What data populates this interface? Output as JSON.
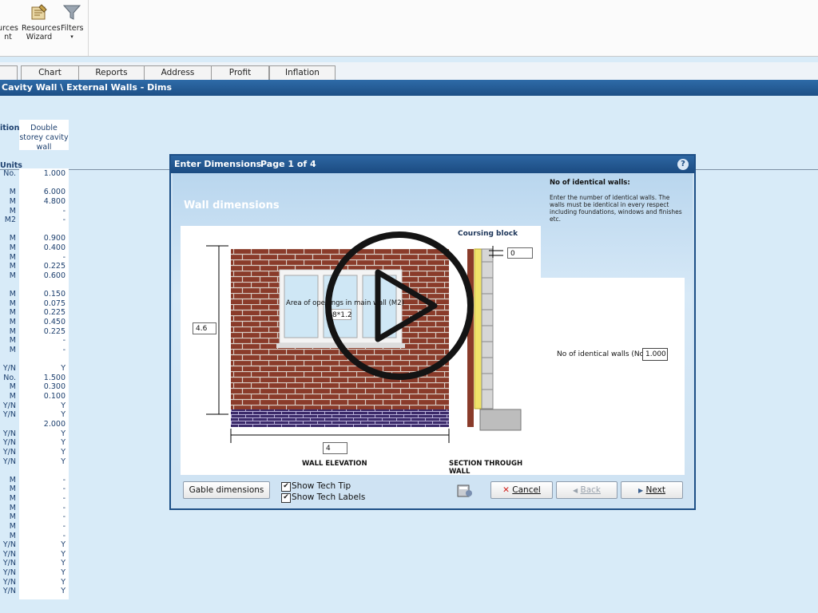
{
  "ribbon": {
    "resources_cut_label_1": "urces",
    "resources_cut_label_2": "nt",
    "resources_wizard_label_1": "Resources",
    "resources_wizard_label_2": "Wizard",
    "filters_label": "Filters",
    "filters_arrow": "▾"
  },
  "tabs": [
    "Chart",
    "Reports",
    "Address",
    "Profit",
    "Inflation"
  ],
  "title_bar": "Cavity Wall \\ External Walls - Dims",
  "grid": {
    "section_label": "ition",
    "units_label": "Units",
    "column_header": "Double storey cavity wall",
    "rows": [
      {
        "unit": "No.",
        "value": "1.000"
      },
      {
        "unit": "",
        "value": ""
      },
      {
        "unit": "M",
        "value": "6.000"
      },
      {
        "unit": "M",
        "value": "4.800"
      },
      {
        "unit": "M",
        "value": "-"
      },
      {
        "unit": "M2",
        "value": "-"
      },
      {
        "unit": "",
        "value": ""
      },
      {
        "unit": "M",
        "value": "0.900"
      },
      {
        "unit": "M",
        "value": "0.400"
      },
      {
        "unit": "M",
        "value": "-"
      },
      {
        "unit": "M",
        "value": "0.225"
      },
      {
        "unit": "M",
        "value": "0.600"
      },
      {
        "unit": "",
        "value": ""
      },
      {
        "unit": "M",
        "value": "0.150"
      },
      {
        "unit": "M",
        "value": "0.075"
      },
      {
        "unit": "M",
        "value": "0.225"
      },
      {
        "unit": "M",
        "value": "0.450"
      },
      {
        "unit": "M",
        "value": "0.225"
      },
      {
        "unit": "M",
        "value": "-"
      },
      {
        "unit": "M",
        "value": "-"
      },
      {
        "unit": "",
        "value": ""
      },
      {
        "unit": "Y/N",
        "value": "Y"
      },
      {
        "unit": "No.",
        "value": "1.500"
      },
      {
        "unit": "M",
        "value": "0.300"
      },
      {
        "unit": "M",
        "value": "0.100"
      },
      {
        "unit": "Y/N",
        "value": "Y"
      },
      {
        "unit": "Y/N",
        "value": "Y"
      },
      {
        "unit": "",
        "value": "2.000"
      },
      {
        "unit": "Y/N",
        "value": "Y"
      },
      {
        "unit": "Y/N",
        "value": "Y"
      },
      {
        "unit": "Y/N",
        "value": "Y"
      },
      {
        "unit": "Y/N",
        "value": "Y"
      },
      {
        "unit": "",
        "value": ""
      },
      {
        "unit": "M",
        "value": "-"
      },
      {
        "unit": "M",
        "value": "-"
      },
      {
        "unit": "M",
        "value": "-"
      },
      {
        "unit": "M",
        "value": "-"
      },
      {
        "unit": "M",
        "value": "-"
      },
      {
        "unit": "M",
        "value": "-"
      },
      {
        "unit": "M",
        "value": "-"
      },
      {
        "unit": "Y/N",
        "value": "Y"
      },
      {
        "unit": "Y/N",
        "value": "Y"
      },
      {
        "unit": "Y/N",
        "value": "Y"
      },
      {
        "unit": "Y/N",
        "value": "Y"
      },
      {
        "unit": "Y/N",
        "value": "Y"
      },
      {
        "unit": "Y/N",
        "value": "Y"
      }
    ]
  },
  "dialog": {
    "title": "Enter Dimensions",
    "page": "Page 1 of 4",
    "help_glyph": "?",
    "heading": "Wall dimensions",
    "tip_title": "No of identical walls:",
    "tip_text": "Enter the number of identical walls. The walls must be identical in every respect including foundations, windows and finishes etc.",
    "coursing_label": "Coursing block",
    "coursing_value": "0",
    "height_value": "4.6",
    "width_value": "4",
    "openings_label": "Area of openings in main wall (M2)",
    "openings_value": "8*1.2",
    "identical_label": "No of identical walls (No.)",
    "identical_value": "1.000",
    "elevation_caption": "WALL ELEVATION",
    "section_caption": "SECTION THROUGH WALL",
    "gable_button": "Gable dimensions",
    "show_tech_tip": "Show Tech Tip",
    "show_tech_labels": "Show Tech Labels",
    "check_mark": "✔",
    "cancel": "Cancel",
    "back": "Back",
    "next": "Next",
    "cancel_icon": "✕",
    "back_icon": "◀",
    "next_icon": "▶"
  },
  "colors": {
    "title_blue": "#1d4f86",
    "brick": "#8a3b2a",
    "cancel_red": "#d0201c"
  },
  "icons": [
    "resources-wizard-icon",
    "filter-funnel-icon",
    "help-icon",
    "play-overlay-icon",
    "calculator-icon"
  ]
}
